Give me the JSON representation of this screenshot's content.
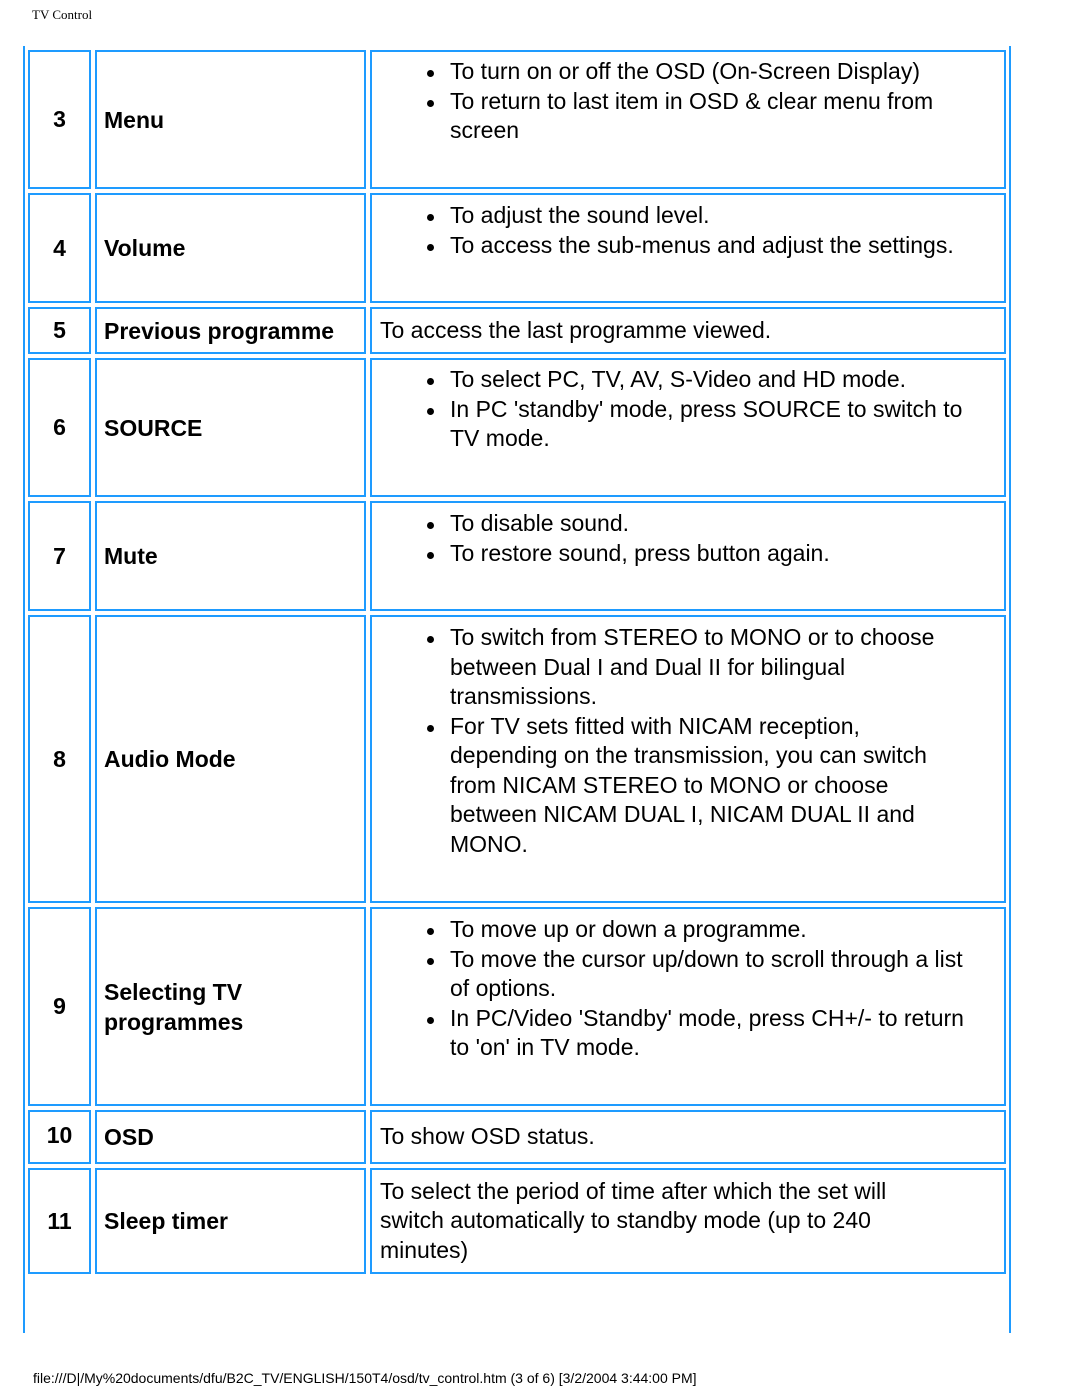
{
  "header": {
    "title": "TV Control"
  },
  "border_color": "#1e9bff",
  "rows": [
    {
      "number": "3",
      "name": "Menu",
      "bullets": [
        "To turn on or off the OSD (On-Screen Display)",
        "To return to last item in OSD & clear menu from screen"
      ]
    },
    {
      "number": "4",
      "name": "Volume",
      "bullets": [
        "To adjust the sound level.",
        "To access the sub-menus and adjust the settings."
      ]
    },
    {
      "number": "5",
      "name": "Previous programme",
      "text": "To access the last programme viewed."
    },
    {
      "number": "6",
      "name": "SOURCE",
      "bullets": [
        "To select PC, TV, AV, S-Video and HD mode.",
        "In PC 'standby' mode, press SOURCE to switch to TV mode."
      ]
    },
    {
      "number": "7",
      "name": "Mute",
      "bullets": [
        "To disable sound.",
        "To restore sound, press button again."
      ]
    },
    {
      "number": "8",
      "name": "Audio Mode",
      "bullets": [
        "To switch from STEREO to MONO or to choose between Dual I and Dual II for bilingual transmissions.",
        "For TV sets fitted with NICAM reception, depending on the transmission, you can switch from NICAM STEREO to MONO or choose between NICAM DUAL I, NICAM DUAL II and MONO."
      ]
    },
    {
      "number": "9",
      "name": "Selecting TV programmes",
      "bullets": [
        "To move up or down a programme.",
        "To move the cursor up/down to scroll through a list of options.",
        "In PC/Video 'Standby' mode, press CH+/- to return to 'on' in TV mode."
      ]
    },
    {
      "number": "10",
      "name": "OSD",
      "text": "To show OSD status."
    },
    {
      "number": "11",
      "name": "Sleep timer",
      "text": "To select the period of time after which the set will switch automatically to standby mode (up to 240 minutes)"
    }
  ],
  "footer": {
    "text": "file:///D|/My%20documents/dfu/B2C_TV/ENGLISH/150T4/osd/tv_control.htm (3 of 6) [3/2/2004 3:44:00 PM]"
  }
}
